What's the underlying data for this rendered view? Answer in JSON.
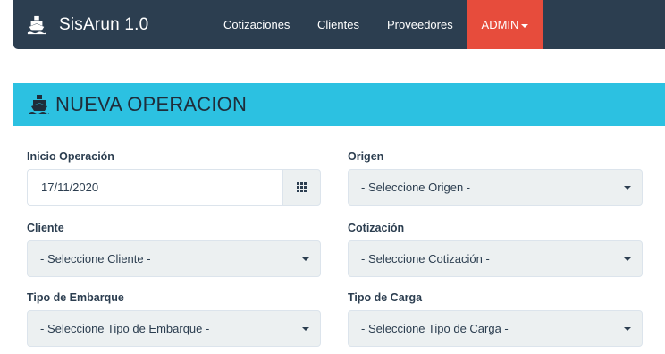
{
  "app": {
    "brand": "SisArun 1.0",
    "brand_icon": "ship-icon"
  },
  "nav": {
    "items": [
      "Cotizaciones",
      "Clientes",
      "Proveedores"
    ],
    "admin": "ADMIN"
  },
  "panel": {
    "title": "NUEVA OPERACION",
    "icon": "ship-icon"
  },
  "form": {
    "inicio_label": "Inicio Operación",
    "inicio_value": "17/11/2020",
    "origen_label": "Origen",
    "origen_value": "- Seleccione Origen -",
    "cliente_label": "Cliente",
    "cliente_value": "- Seleccione Cliente -",
    "cotizacion_label": "Cotización",
    "cotizacion_value": "- Seleccione Cotización -",
    "embarque_label": "Tipo de Embarque",
    "embarque_value": "- Seleccione Tipo de Embarque -",
    "carga_label": "Tipo de Carga",
    "carga_value": "- Seleccione Tipo de Carga -"
  },
  "colors": {
    "navbar": "#2c3e50",
    "admin": "#e74c3c",
    "panel_heading": "#2cc1e1"
  }
}
